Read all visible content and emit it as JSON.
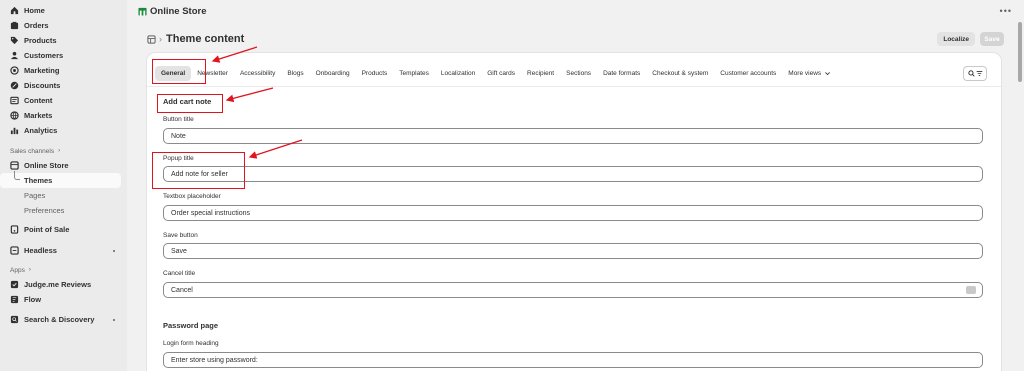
{
  "sidebar": {
    "items": [
      {
        "label": "Home",
        "icon": "home-icon"
      },
      {
        "label": "Orders",
        "icon": "orders-icon"
      },
      {
        "label": "Products",
        "icon": "tag-icon"
      },
      {
        "label": "Customers",
        "icon": "person-icon"
      },
      {
        "label": "Marketing",
        "icon": "target-icon"
      },
      {
        "label": "Discounts",
        "icon": "discount-icon"
      },
      {
        "label": "Content",
        "icon": "content-icon"
      },
      {
        "label": "Markets",
        "icon": "globe-icon"
      },
      {
        "label": "Analytics",
        "icon": "chart-icon"
      }
    ],
    "sales_channels_label": "Sales channels",
    "online_store": "Online Store",
    "themes": "Themes",
    "pages": "Pages",
    "preferences": "Preferences",
    "point_of_sale": "Point of Sale",
    "headless": "Headless",
    "apps_label": "Apps",
    "judge_me": "Judge.me Reviews",
    "flow": "Flow",
    "search_discovery": "Search & Discovery"
  },
  "topbar": {
    "title": "Online Store",
    "more": "•••"
  },
  "header": {
    "title": "Theme content",
    "separator": "›",
    "localize": "Localize",
    "save": "Save"
  },
  "tabs": [
    "General",
    "Newsletter",
    "Accessibility",
    "Blogs",
    "Onboarding",
    "Products",
    "Templates",
    "Localization",
    "Gift cards",
    "Recipient",
    "Sections",
    "Date formats",
    "Checkout & system",
    "Customer accounts",
    "More views"
  ],
  "active_tab": "General",
  "cart_note": {
    "title": "Add cart note",
    "button_title_label": "Button title",
    "button_title_value": "Note",
    "popup_title_label": "Popup title",
    "popup_title_value": "Add note for seller",
    "textbox_placeholder_label": "Textbox placeholder",
    "textbox_placeholder_value": "Order special instructions",
    "save_button_label": "Save button",
    "save_button_value": "Save",
    "cancel_title_label": "Cancel title",
    "cancel_title_value": "Cancel"
  },
  "password_page": {
    "title": "Password page",
    "login_heading_label": "Login form heading",
    "login_heading_value": "Enter store using password:"
  },
  "colors": {
    "annotation": "#e0141e",
    "brand_green": "#1a8a3c"
  }
}
